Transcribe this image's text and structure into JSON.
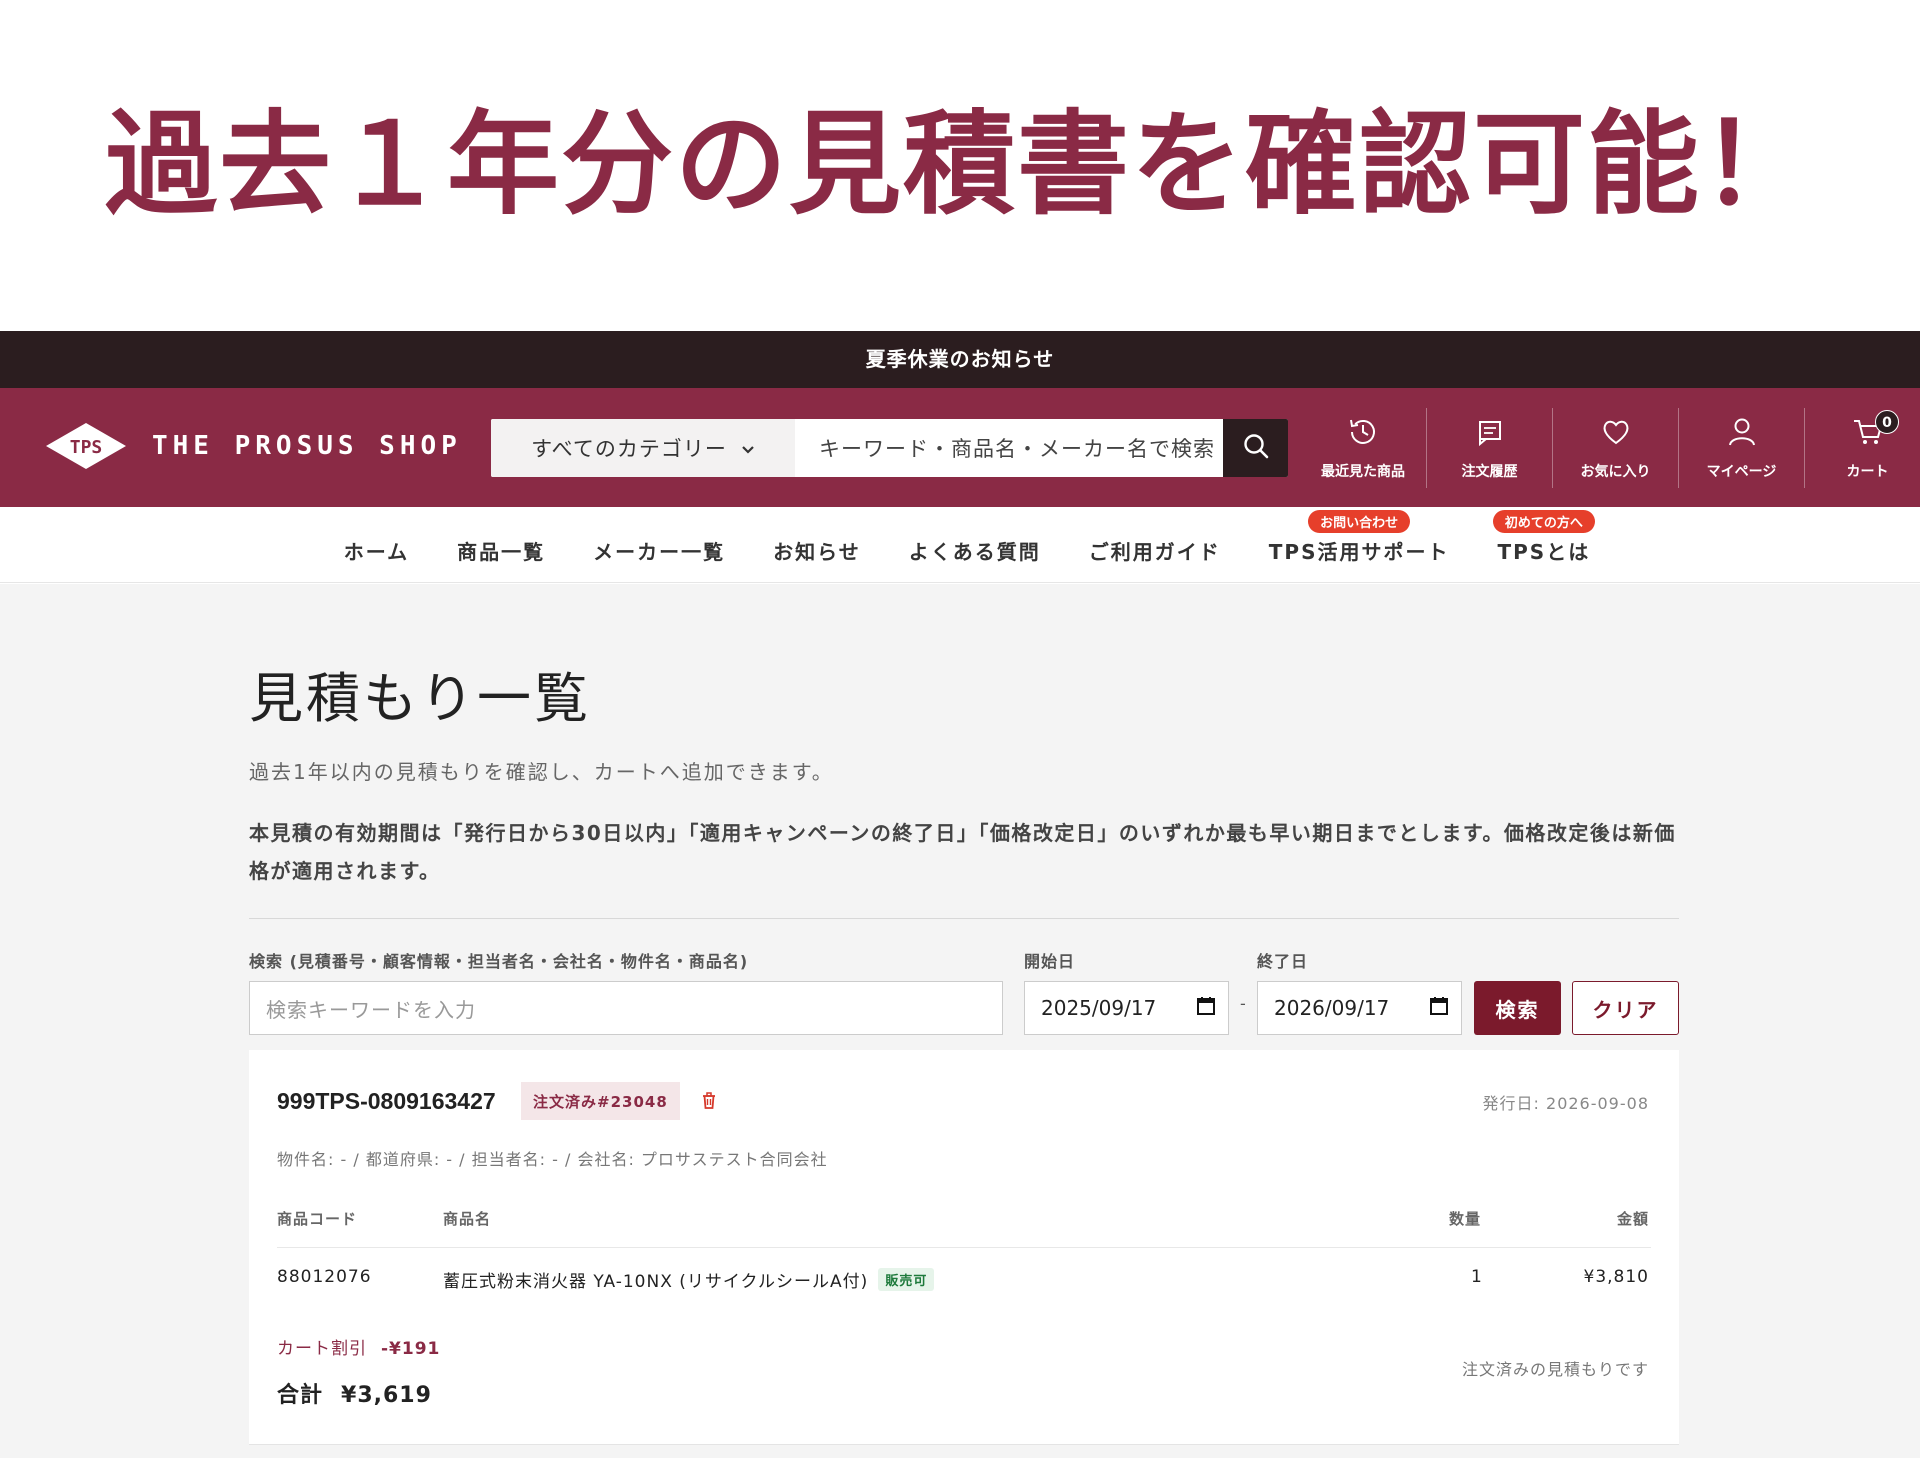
{
  "headline": "過去１年分の見積書を確認可能！",
  "announcement": "夏季休業のお知らせ",
  "header": {
    "logo_mark": "TPS",
    "logo_text": "THE PROSUS SHOP",
    "category_label": "すべてのカテゴリー",
    "search_placeholder": "キーワード・商品名・メーカー名で検索",
    "icons": [
      {
        "label": "最近見た商品",
        "icon": "history-icon"
      },
      {
        "label": "注文履歴",
        "icon": "receipt-icon"
      },
      {
        "label": "お気に入り",
        "icon": "heart-icon"
      },
      {
        "label": "マイページ",
        "icon": "user-icon"
      },
      {
        "label": "カート",
        "icon": "cart-icon"
      }
    ],
    "cart_count": "0"
  },
  "nav": {
    "items": [
      {
        "label": "ホーム"
      },
      {
        "label": "商品一覧"
      },
      {
        "label": "メーカー一覧"
      },
      {
        "label": "お知らせ"
      },
      {
        "label": "よくある質問"
      },
      {
        "label": "ご利用ガイド"
      },
      {
        "label": "TPS活用サポート",
        "badge": "お問い合わせ"
      },
      {
        "label": "TPSとは",
        "badge": "初めての方へ"
      }
    ]
  },
  "page": {
    "title": "見積もり一覧",
    "description": "過去1年以内の見積もりを確認し、カートへ追加できます。",
    "note": "本見積の有効期間は「発行日から30日以内」「適用キャンペーンの終了日」「価格改定日」のいずれか最も早い期日までとします。価格改定後は新価格が適用されます。"
  },
  "filters": {
    "keyword_label": "検索 (見積番号・顧客情報・担当者名・会社名・物件名・商品名)",
    "keyword_placeholder": "検索キーワードを入力",
    "start_label": "開始日",
    "start_value": "2025/09/17",
    "end_label": "終了日",
    "end_value": "2026/09/17",
    "separator": "-",
    "search_button": "検索",
    "clear_button": "クリア"
  },
  "quote": {
    "number": "999TPS-0809163427",
    "status_badge": "注文済み#23048",
    "issue_date": "発行日: 2026-09-08",
    "meta": "物件名: - / 都道府県: - / 担当者名: - / 会社名: プロサステスト合同会社",
    "columns": {
      "code": "商品コード",
      "name": "商品名",
      "qty": "数量",
      "amount": "金額"
    },
    "items": [
      {
        "code": "88012076",
        "name": "蓄圧式粉末消火器 YA-10NX (リサイクルシールA付)",
        "badge": "販売可",
        "qty": "1",
        "amount": "¥3,810"
      }
    ],
    "discount_label": "カート割引",
    "discount_value": "-¥191",
    "total_label": "合計",
    "total_value": "¥3,619",
    "ordered_note": "注文済みの見積もりです"
  },
  "colors": {
    "brand": "#8a2a45",
    "dark": "#2b1d1f",
    "accent_badge": "#e63f2b"
  }
}
